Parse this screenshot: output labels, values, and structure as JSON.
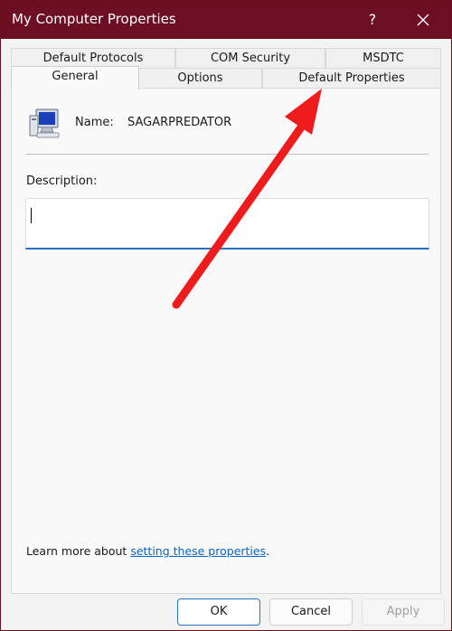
{
  "window": {
    "title": "My Computer Properties",
    "help_label": "?"
  },
  "tabs": {
    "row_top": [
      "Default Protocols",
      "COM Security",
      "MSDTC"
    ],
    "row_bottom": [
      "General",
      "Options",
      "Default Properties"
    ],
    "active": "General"
  },
  "general": {
    "name_label": "Name:",
    "name_value": "SAGARPREDATOR",
    "description_label": "Description:",
    "description_value": "",
    "learn_prefix": "Learn more about ",
    "learn_link": "setting these properties",
    "learn_suffix": "."
  },
  "buttons": {
    "ok": "OK",
    "cancel": "Cancel",
    "apply": "Apply"
  },
  "colors": {
    "titlebar": "#6d0f22",
    "accent": "#2c6fbd",
    "annotation_arrow": "#ee1c1c"
  },
  "icons": {
    "computer": "computer-monitor-icon",
    "close": "close-icon",
    "arrow": "annotation-arrow"
  }
}
